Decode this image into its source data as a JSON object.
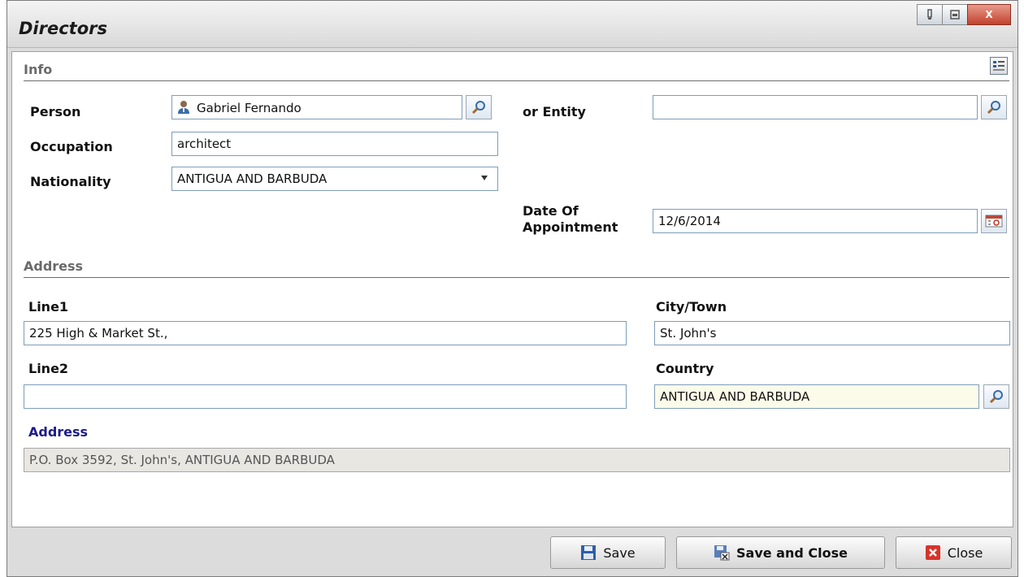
{
  "window": {
    "title": "Directors",
    "controls": {
      "minimize": "▯",
      "restore": "▭",
      "close": "X"
    }
  },
  "info": {
    "section_label": "Info",
    "person": {
      "label": "Person",
      "value": "Gabriel Fernando"
    },
    "entity": {
      "label": "or Entity",
      "value": ""
    },
    "occupation": {
      "label": "Occupation",
      "value": "architect"
    },
    "nationality": {
      "label": "Nationality",
      "value": "ANTIGUA AND BARBUDA"
    },
    "date_of_appointment": {
      "label_line1": "Date Of",
      "label_line2": "Appointment",
      "value": "12/6/2014"
    }
  },
  "address": {
    "section_label": "Address",
    "line1": {
      "label": "Line1",
      "value": "225 High & Market St.,"
    },
    "line2": {
      "label": "Line2",
      "value": ""
    },
    "city": {
      "label": "City/Town",
      "value": "St. John's"
    },
    "country": {
      "label": "Country",
      "value": "ANTIGUA AND BARBUDA"
    },
    "full": {
      "label": "Address",
      "value": "P.O. Box 3592, St. John's, ANTIGUA AND BARBUDA"
    }
  },
  "footer": {
    "save_label": "Save",
    "save_close_label": "Save and Close",
    "close_label": "Close"
  },
  "colors": {
    "address_label": "#1c1c8a",
    "field_border": "#7f9db9",
    "readonly_bg": "#e8e7e2",
    "country_bg": "#fbfbe9"
  }
}
